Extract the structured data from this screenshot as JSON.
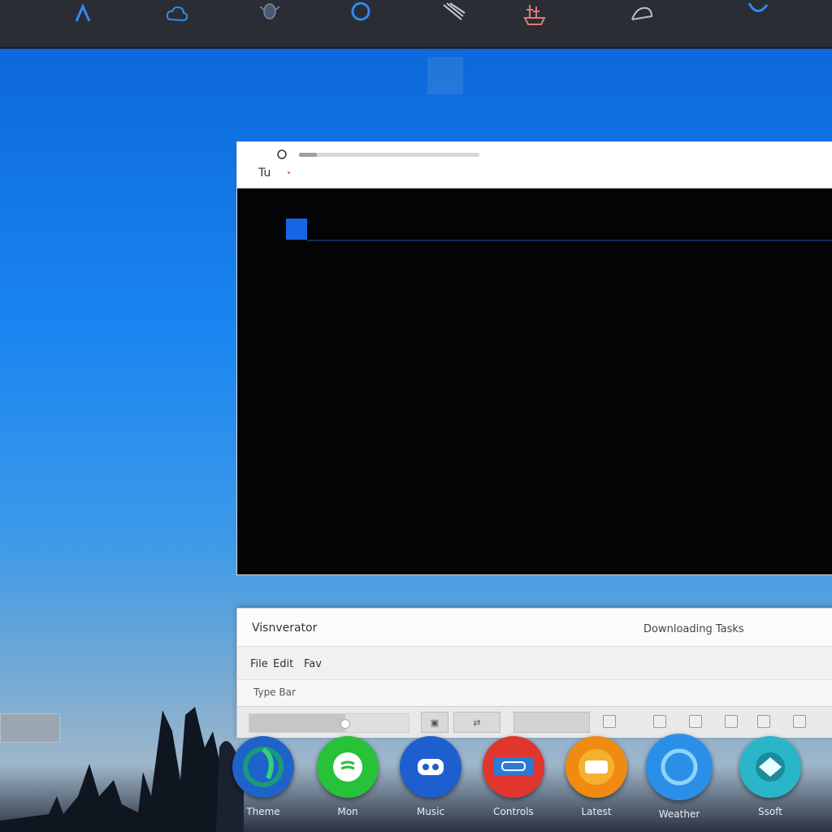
{
  "topbar": {
    "icons": [
      "chevron-up-icon",
      "cloud-icon",
      "bug-icon",
      "circle-icon",
      "brush-icon",
      "ship-icon",
      "bird-icon",
      "leaf-icon"
    ]
  },
  "terminal": {
    "title_label": "Tu",
    "search_icon": "search-icon",
    "progress": 0.1
  },
  "dialog": {
    "title": "Visnverator",
    "status": "Downloading Tasks",
    "nav_items": [
      "File",
      "Edit",
      "Fav"
    ],
    "path": "Type Bar",
    "slider_value": 0.6,
    "toolbar_icons": [
      "copy-icon",
      "link-icon",
      "paste-icon",
      "zoom-icon",
      "refresh-icon",
      "close-icon",
      "settings-icon"
    ]
  },
  "dock": {
    "items": [
      {
        "label": "Theme",
        "icon": "edge-icon",
        "color": "#1f63c9"
      },
      {
        "label": "Mon",
        "icon": "spotify-icon",
        "color": "#28c13a"
      },
      {
        "label": "Music",
        "icon": "people-icon",
        "color": "#1d5fcf"
      },
      {
        "label": "Controls",
        "icon": "gamepad-icon",
        "color": "#e0362e"
      },
      {
        "label": "Latest",
        "icon": "chat-icon",
        "color": "#f08b12"
      },
      {
        "label": "Weather",
        "icon": "cortana-icon",
        "color": "#2b8fe8"
      },
      {
        "label": "Ssoft",
        "icon": "map-icon",
        "color": "#29b6c9"
      }
    ]
  }
}
